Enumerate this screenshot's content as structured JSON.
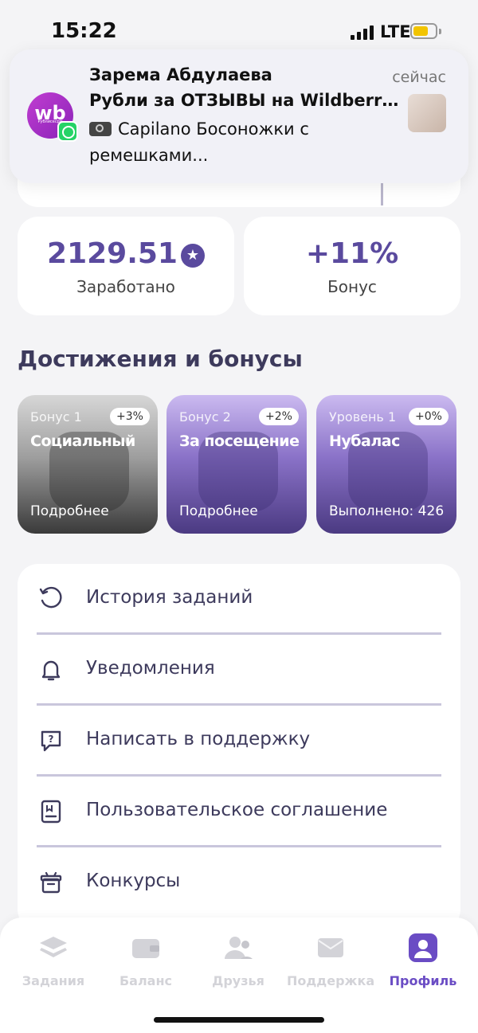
{
  "status_bar": {
    "time": "15:22",
    "network": "LTE"
  },
  "notification": {
    "app_icon_text": "wb",
    "app_icon_caption": "Рублисесрм",
    "sender": "Зарема Абдулаева",
    "time": "сейчас",
    "title": "Рубли за ОТЗЫВЫ на Wildberrie...",
    "body": "Capilano Босоножки с ремешками..."
  },
  "stats": {
    "earned": {
      "value": "2129.51",
      "label": "Заработано"
    },
    "bonus": {
      "value": "+11%",
      "label": "Бонус"
    }
  },
  "achievements": {
    "title": "Достижения и бонусы",
    "cards": [
      {
        "kind": "Бонус 1",
        "badge": "+3%",
        "name": "Социальный",
        "footer": "Подробнее"
      },
      {
        "kind": "Бонус 2",
        "badge": "+2%",
        "name": "За посещение",
        "footer": "Подробнее"
      },
      {
        "kind": "Уровень 1",
        "badge": "+0%",
        "name": "Нубалас",
        "footer": "Выполнено: 426"
      }
    ]
  },
  "menu": {
    "items": [
      {
        "label": "История заданий",
        "icon": "history-icon"
      },
      {
        "label": "Уведомления",
        "icon": "bell-icon"
      },
      {
        "label": "Написать в поддержку",
        "icon": "help-chat-icon"
      },
      {
        "label": "Пользовательское соглашение",
        "icon": "document-icon"
      },
      {
        "label": "Конкурсы",
        "icon": "gift-icon"
      }
    ]
  },
  "tabs": [
    {
      "label": "Задания",
      "icon": "layers-icon"
    },
    {
      "label": "Баланс",
      "icon": "wallet-icon"
    },
    {
      "label": "Друзья",
      "icon": "friends-icon"
    },
    {
      "label": "Поддержка",
      "icon": "mail-icon"
    },
    {
      "label": "Профиль",
      "icon": "profile-icon",
      "active": true
    }
  ],
  "colors": {
    "accent": "#5a4a9e",
    "active_tab": "#6a4cc4",
    "divider": "#c9c6dc"
  }
}
